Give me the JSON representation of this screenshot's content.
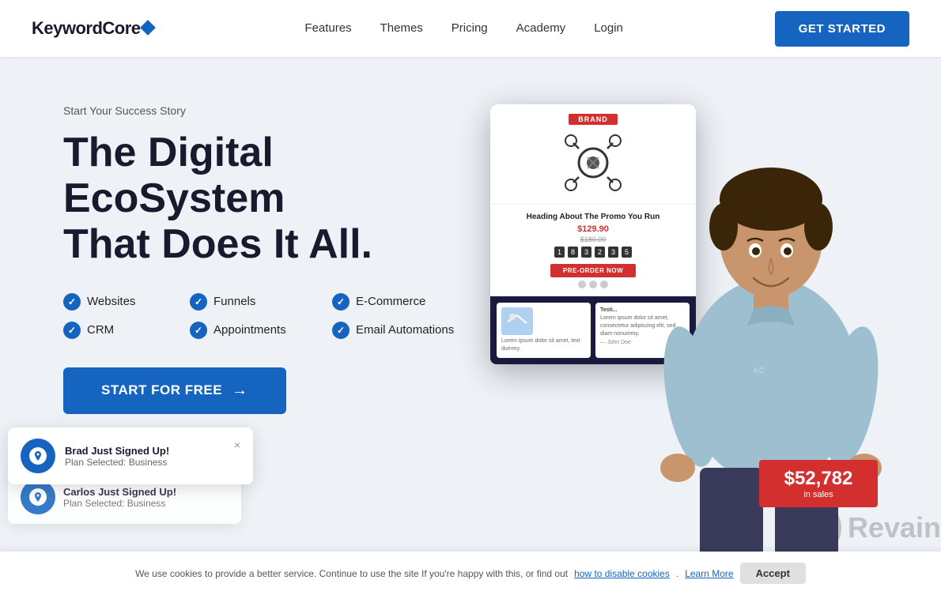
{
  "navbar": {
    "logo_text": "KeywordCore",
    "nav_links": [
      {
        "label": "Features",
        "href": "#"
      },
      {
        "label": "Themes",
        "href": "#"
      },
      {
        "label": "Pricing",
        "href": "#"
      },
      {
        "label": "Academy",
        "href": "#"
      },
      {
        "label": "Login",
        "href": "#"
      }
    ],
    "cta_label": "GET STARTED"
  },
  "hero": {
    "subtitle": "Start Your Success Story",
    "title_line1": "The Digital EcoSystem",
    "title_line2": "That Does It All.",
    "features": [
      {
        "icon": "check",
        "label": "Websites"
      },
      {
        "icon": "check",
        "label": "Funnels"
      },
      {
        "icon": "check",
        "label": "E-Commerce"
      },
      {
        "icon": "check",
        "label": "CRM"
      },
      {
        "icon": "check",
        "label": "Appointments"
      },
      {
        "icon": "check",
        "label": "Email Automations"
      }
    ],
    "cta_label": "START FOR FREE",
    "cta_arrow": "→"
  },
  "dashboard_preview": {
    "brand_badge": "BRAND",
    "heading": "Heading About The Promo You Run",
    "price": "$129.90",
    "original_price": "$180.00",
    "countdown": [
      "1",
      "8",
      "3",
      "2",
      "3",
      "5"
    ],
    "preorder_btn": "PRE-ORDER NOW",
    "sales_amount": "$52,782",
    "sales_label": "in sales"
  },
  "notification": {
    "name": "Brad Just Signed Up!",
    "desc": "Plan Selected: Business",
    "close": "×"
  },
  "notification2": {
    "name": "Carlos Just Signed Up!",
    "desc": "Plan Selected: Business"
  },
  "cookie_banner": {
    "text": "We use cookies to provide a better service. Continue to use the site If you're happy with this, or find out",
    "link_text": "how to disable cookies",
    "separator": ".",
    "learn_more": "Learn More",
    "accept_label": "Accept"
  },
  "revain": {
    "logo": "R",
    "text": "Revain"
  },
  "colors": {
    "primary": "#1565c0",
    "danger": "#d32f2f",
    "dark": "#1a1a2e",
    "bg": "#eef2f7"
  }
}
